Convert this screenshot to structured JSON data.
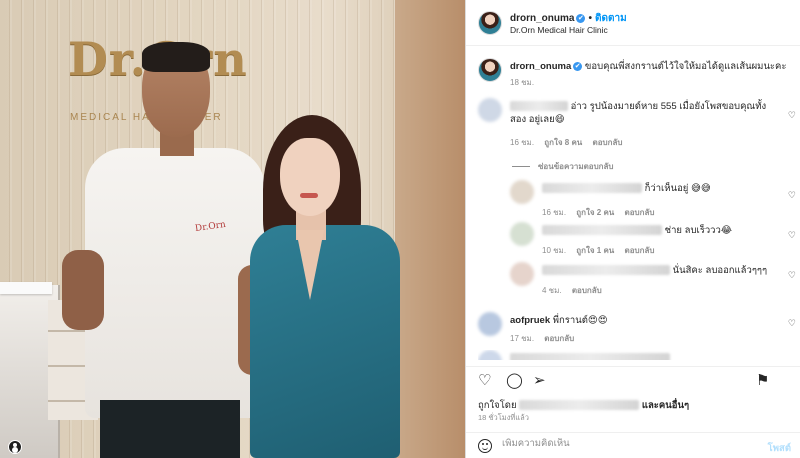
{
  "photo": {
    "logo_text": "Dr.Orn",
    "logo_subtitle": "MEDICAL HAIR CENTER",
    "shirt_print": "Dr.Orn"
  },
  "header": {
    "username": "drorn_onuma",
    "verified": "✔",
    "separator": "•",
    "follow_label": "ติดตาม",
    "subtitle": "Dr.Orn Medical Hair Clinic"
  },
  "caption": {
    "username": "drorn_onuma",
    "text": "ขอบคุณพี่สงกรานต์ไว้ใจให้มอได้ดูแลเส้นผมนะคะ",
    "time": "18 ชม."
  },
  "comments": [
    {
      "text": "อ่าว รูปน้องมายด์หาย 555 เมื่อยังโพสขอบคุณทั้งสอง อยู่เลย😄",
      "time": "16 ชม.",
      "likes": "ถูกใจ 8 คน",
      "reply_label": "ตอบกลับ"
    },
    {
      "username": "aofpruek",
      "text": "พี่กรานต์😍😍",
      "time": "17 ชม.",
      "reply_label": "ตอบกลับ"
    }
  ],
  "reply_toggle": "ซ่อนข้อความตอบกลับ",
  "replies": [
    {
      "text": "ก็ว่าเห็นอยู่ 😅😅",
      "time": "16 ชม.",
      "likes": "ถูกใจ 2 คน",
      "reply_label": "ตอบกลับ"
    },
    {
      "text": "ช่าย ลบเร็ววว😂",
      "time": "10 ชม.",
      "likes": "ถูกใจ 1 คน",
      "reply_label": "ตอบกลับ"
    },
    {
      "text": "นั่นสิคะ ลบออกแล้วๆๆๆ",
      "time": "4 ชม.",
      "reply_label": "ตอบกลับ"
    }
  ],
  "liked_by": {
    "prefix": "ถูกใจโดย",
    "suffix": "และคนอื่นๆ",
    "time": "18 ชั่วโมงที่แล้ว"
  },
  "add_comment": {
    "placeholder": "เพิ่มความคิดเห็น",
    "post_label": "โพสต์"
  },
  "icons": {
    "like": "♡",
    "comment": "◯",
    "share": "➢",
    "save": "⚑",
    "comment_heart": "♡"
  }
}
